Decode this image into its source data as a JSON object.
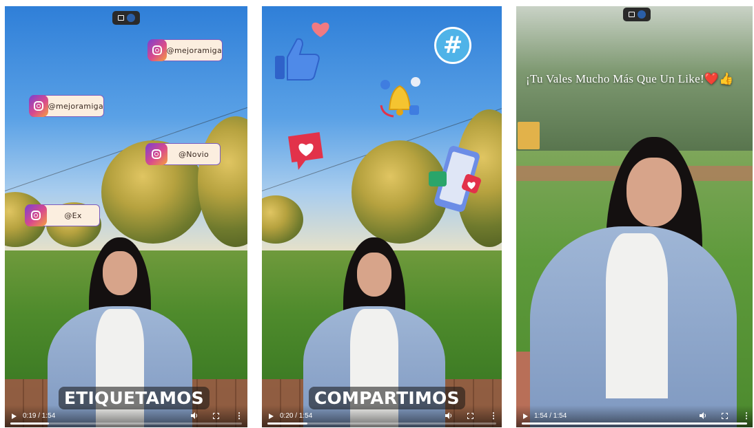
{
  "panels": [
    {
      "tags": [
        "@mejoramiga",
        "@mejoramiga",
        "@Novio",
        "@Ex"
      ],
      "caption": "ETIQUETAMOS",
      "time": "0:19 / 1:54",
      "progress": 0.166
    },
    {
      "caption": "COMPARTIMOS",
      "time": "0:20 / 1:54",
      "progress": 0.175,
      "stickers": [
        "thumbs-up-icon",
        "heart-icon",
        "hashtag-icon",
        "bell-icon",
        "heart-chat-icon",
        "phone-like-icon"
      ]
    },
    {
      "quote": "¡Tu Vales Mucho Más Que Un Like!❤️👍",
      "time": "1:54 / 1:54",
      "progress": 1.0
    }
  ],
  "icons": {
    "play": "play-icon",
    "volume": "volume-icon",
    "fullscreen": "fullscreen-icon",
    "more": "more-options-icon"
  },
  "colors": {
    "tag_border": "#7a5bbf",
    "tag_bg": "#fbeedf",
    "ig_gradient": [
      "#7a3fd1",
      "#d94b8c",
      "#f5a03d"
    ],
    "hashtag": "#4fb3e8",
    "sticker_red": "#e2324a",
    "thumb_blue": "#3f7de0"
  }
}
